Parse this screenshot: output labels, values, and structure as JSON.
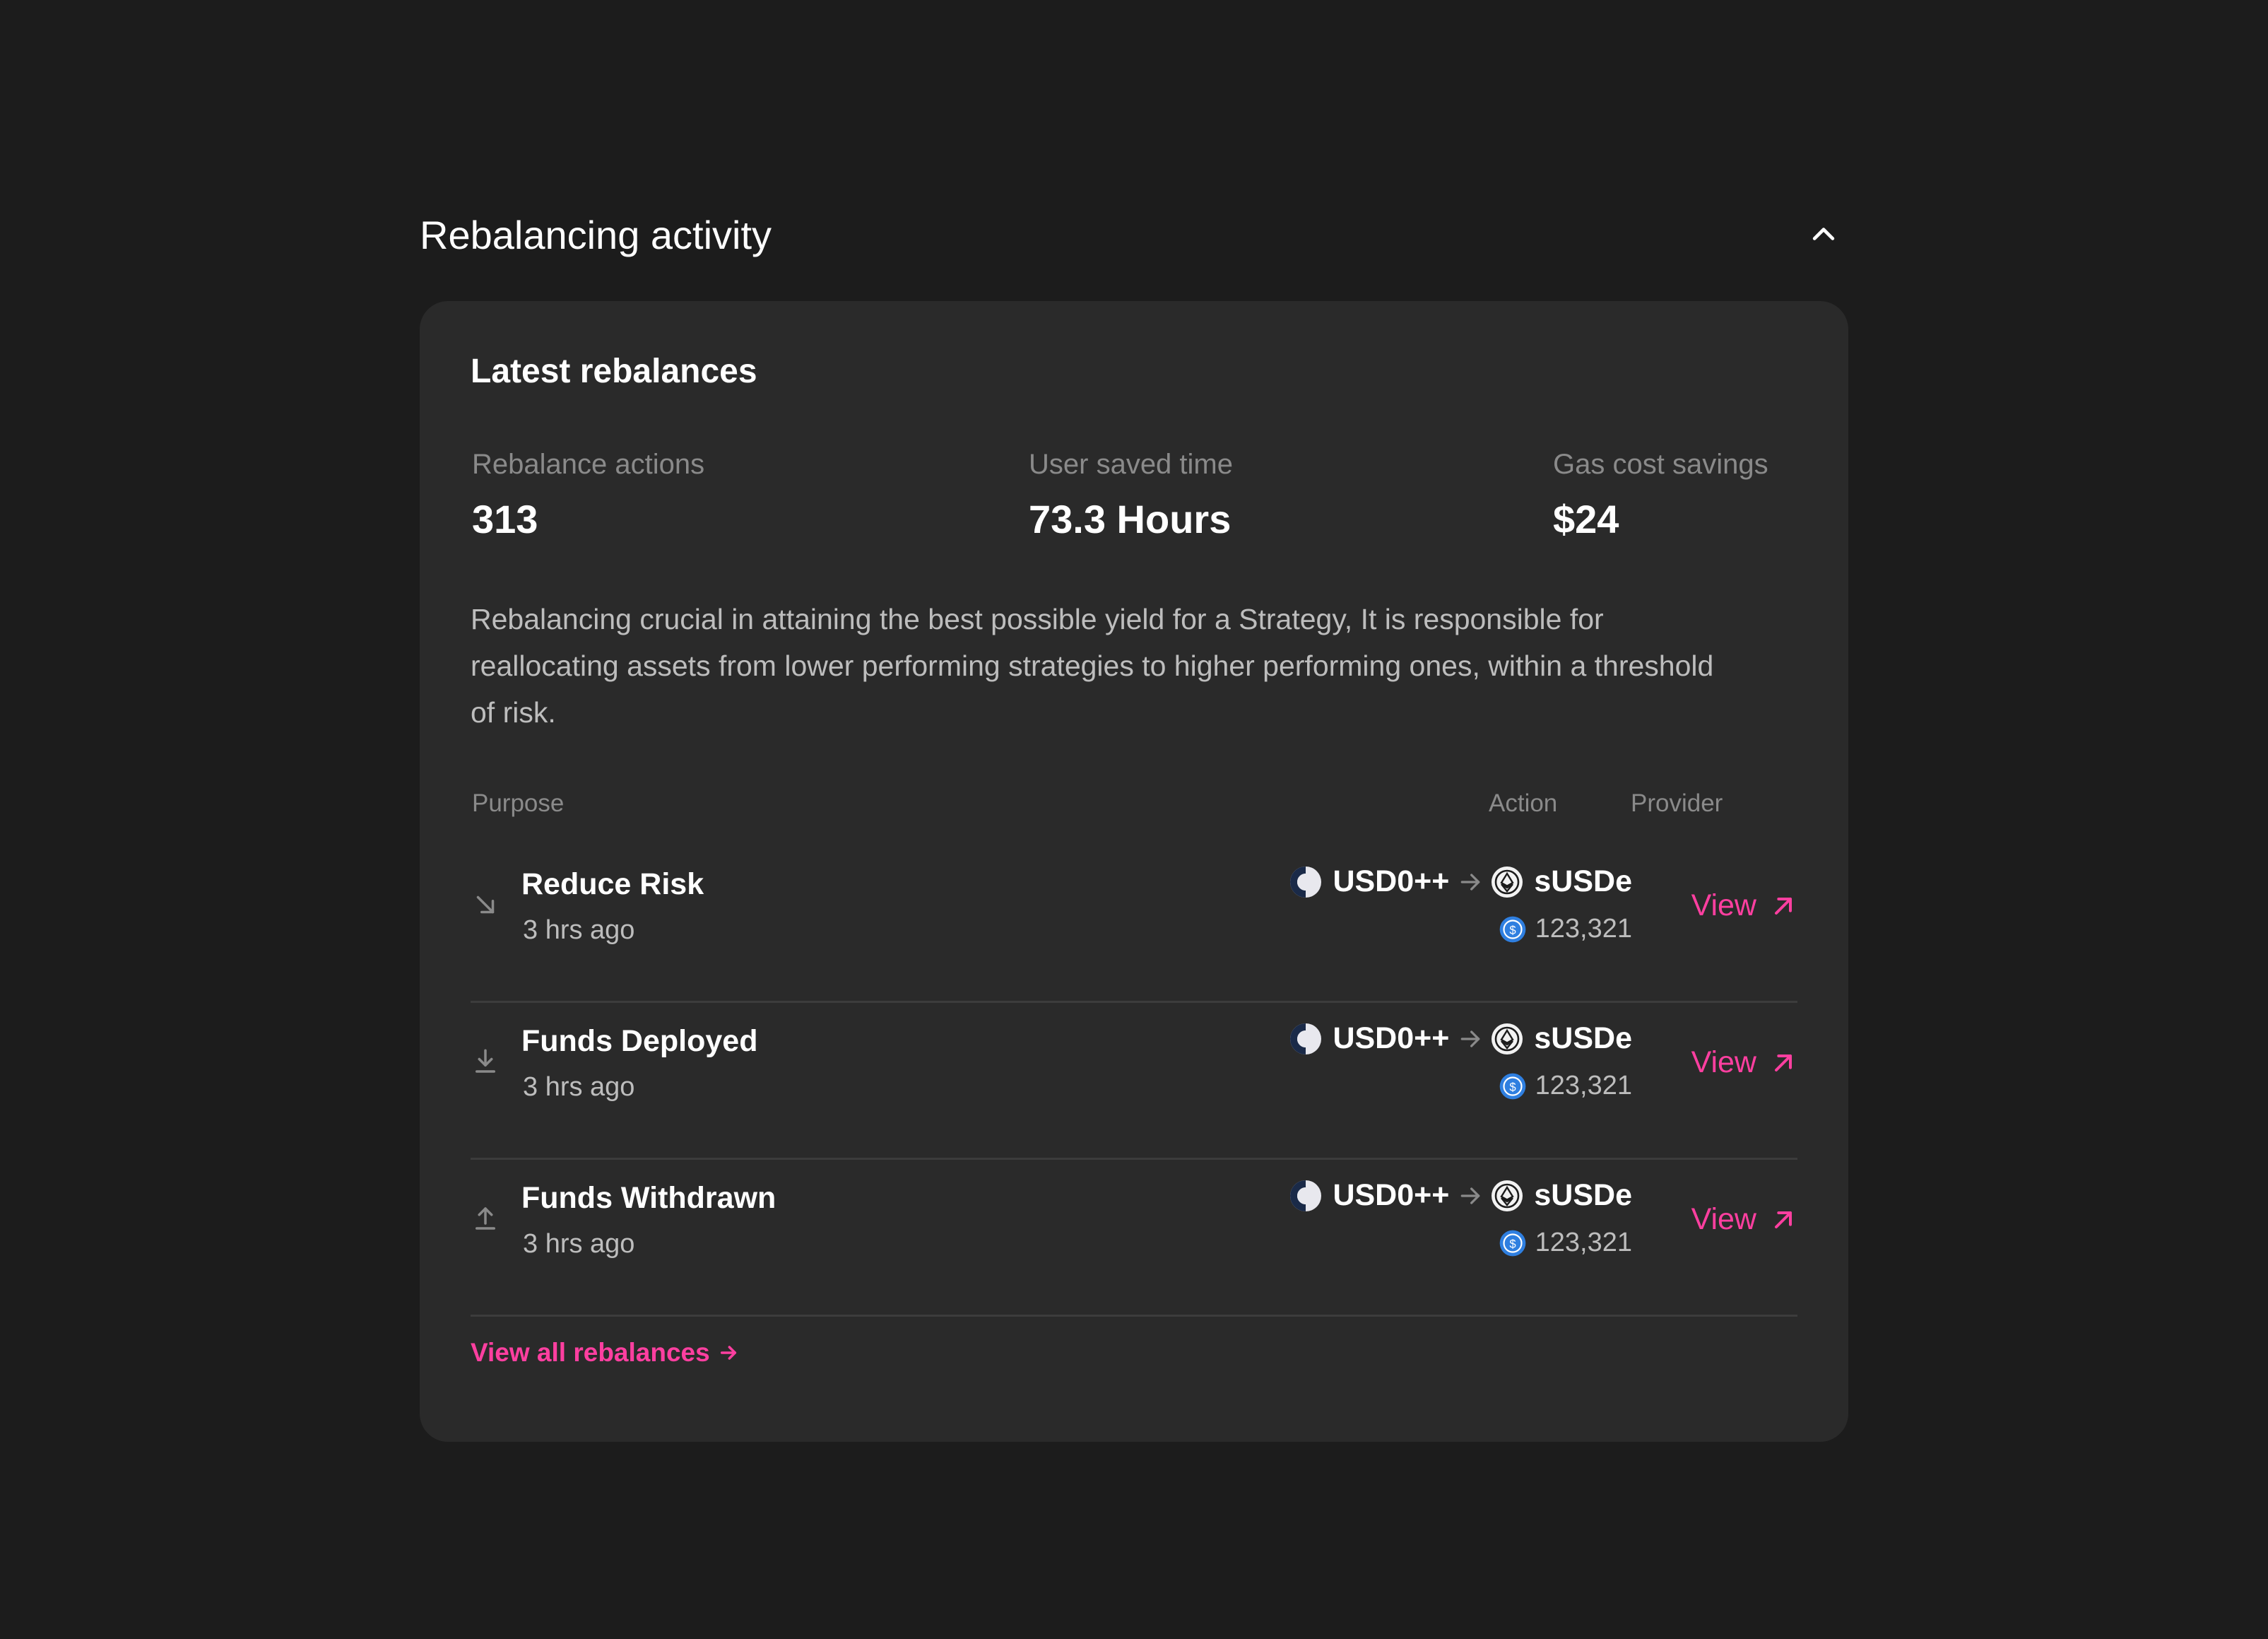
{
  "section": {
    "title": "Rebalancing activity"
  },
  "card": {
    "title": "Latest rebalances",
    "stats": [
      {
        "label": "Rebalance actions",
        "value": "313"
      },
      {
        "label": "User saved time",
        "value": "73.3 Hours"
      },
      {
        "label": "Gas cost savings",
        "value": "$24"
      }
    ],
    "description": "Rebalancing crucial in attaining the best possible yield for a Strategy, It is responsible for reallocating assets from lower performing strategies to higher performing ones, within a threshold of risk.",
    "table": {
      "headers": {
        "purpose": "Purpose",
        "action": "Action",
        "provider": "Provider"
      },
      "rows": [
        {
          "purpose": "Reduce Risk",
          "time": "3 hrs ago",
          "purpose_icon": "arrow-down-right-icon",
          "from": "USD0++",
          "to": "sUSDe",
          "amount": "123,321",
          "provider_label": "View"
        },
        {
          "purpose": "Funds Deployed",
          "time": "3 hrs ago",
          "purpose_icon": "download-icon",
          "from": "USD0++",
          "to": "sUSDe",
          "amount": "123,321",
          "provider_label": "View"
        },
        {
          "purpose": "Funds Withdrawn",
          "time": "3 hrs ago",
          "purpose_icon": "upload-icon",
          "from": "USD0++",
          "to": "sUSDe",
          "amount": "123,321",
          "provider_label": "View"
        }
      ]
    },
    "view_all": "View all rebalances"
  },
  "colors": {
    "background": "#1c1c1c",
    "card": "#2a2a2a",
    "accent": "#ff3fa0",
    "muted": "#8a8a8a",
    "usdc_blue": "#2f7fe0"
  }
}
